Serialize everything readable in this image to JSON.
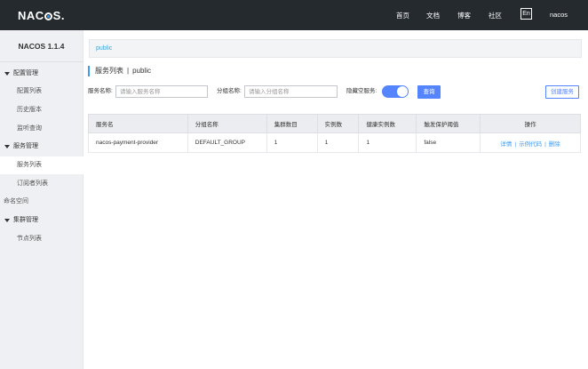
{
  "header": {
    "logo": "NACOS.",
    "nav": [
      "首页",
      "文档",
      "博客",
      "社区"
    ],
    "lang": "En",
    "user": "nacos"
  },
  "sidebar": {
    "version": "NACOS 1.1.4",
    "groups": [
      {
        "label": "配置管理",
        "items": [
          "配置列表",
          "历史版本",
          "监听查询"
        ]
      },
      {
        "label": "服务管理",
        "items": [
          "服务列表",
          "订阅者列表"
        ]
      },
      {
        "label": "命名空间"
      },
      {
        "label": "集群管理",
        "items": [
          "节点列表"
        ]
      }
    ],
    "active": "服务列表"
  },
  "namespace": {
    "current": "public"
  },
  "page": {
    "title": "服务列表",
    "separator": "|",
    "namespace": "public"
  },
  "filters": {
    "service_label": "服务名称:",
    "service_placeholder": "请输入服务名称",
    "group_label": "分组名称:",
    "group_placeholder": "请输入分组名称",
    "hide_empty_label": "隐藏空服务:",
    "hide_empty_on": true,
    "query_button": "查询",
    "create_button": "创建服务"
  },
  "table": {
    "columns": [
      "服务名",
      "分组名称",
      "集群数目",
      "实例数",
      "健康实例数",
      "触发保护阈值",
      "操作"
    ],
    "rows": [
      {
        "service": "nacos-payment-provider",
        "group": "DEFAULT_GROUP",
        "clusters": "1",
        "instances": "1",
        "healthy": "1",
        "threshold": "false",
        "ops": [
          "详情",
          "示例代码",
          "删除"
        ]
      }
    ],
    "op_separator": "|"
  },
  "colors": {
    "topbar": "#252a2f",
    "primary": "#5584ff",
    "link": "#3b9cf2"
  }
}
